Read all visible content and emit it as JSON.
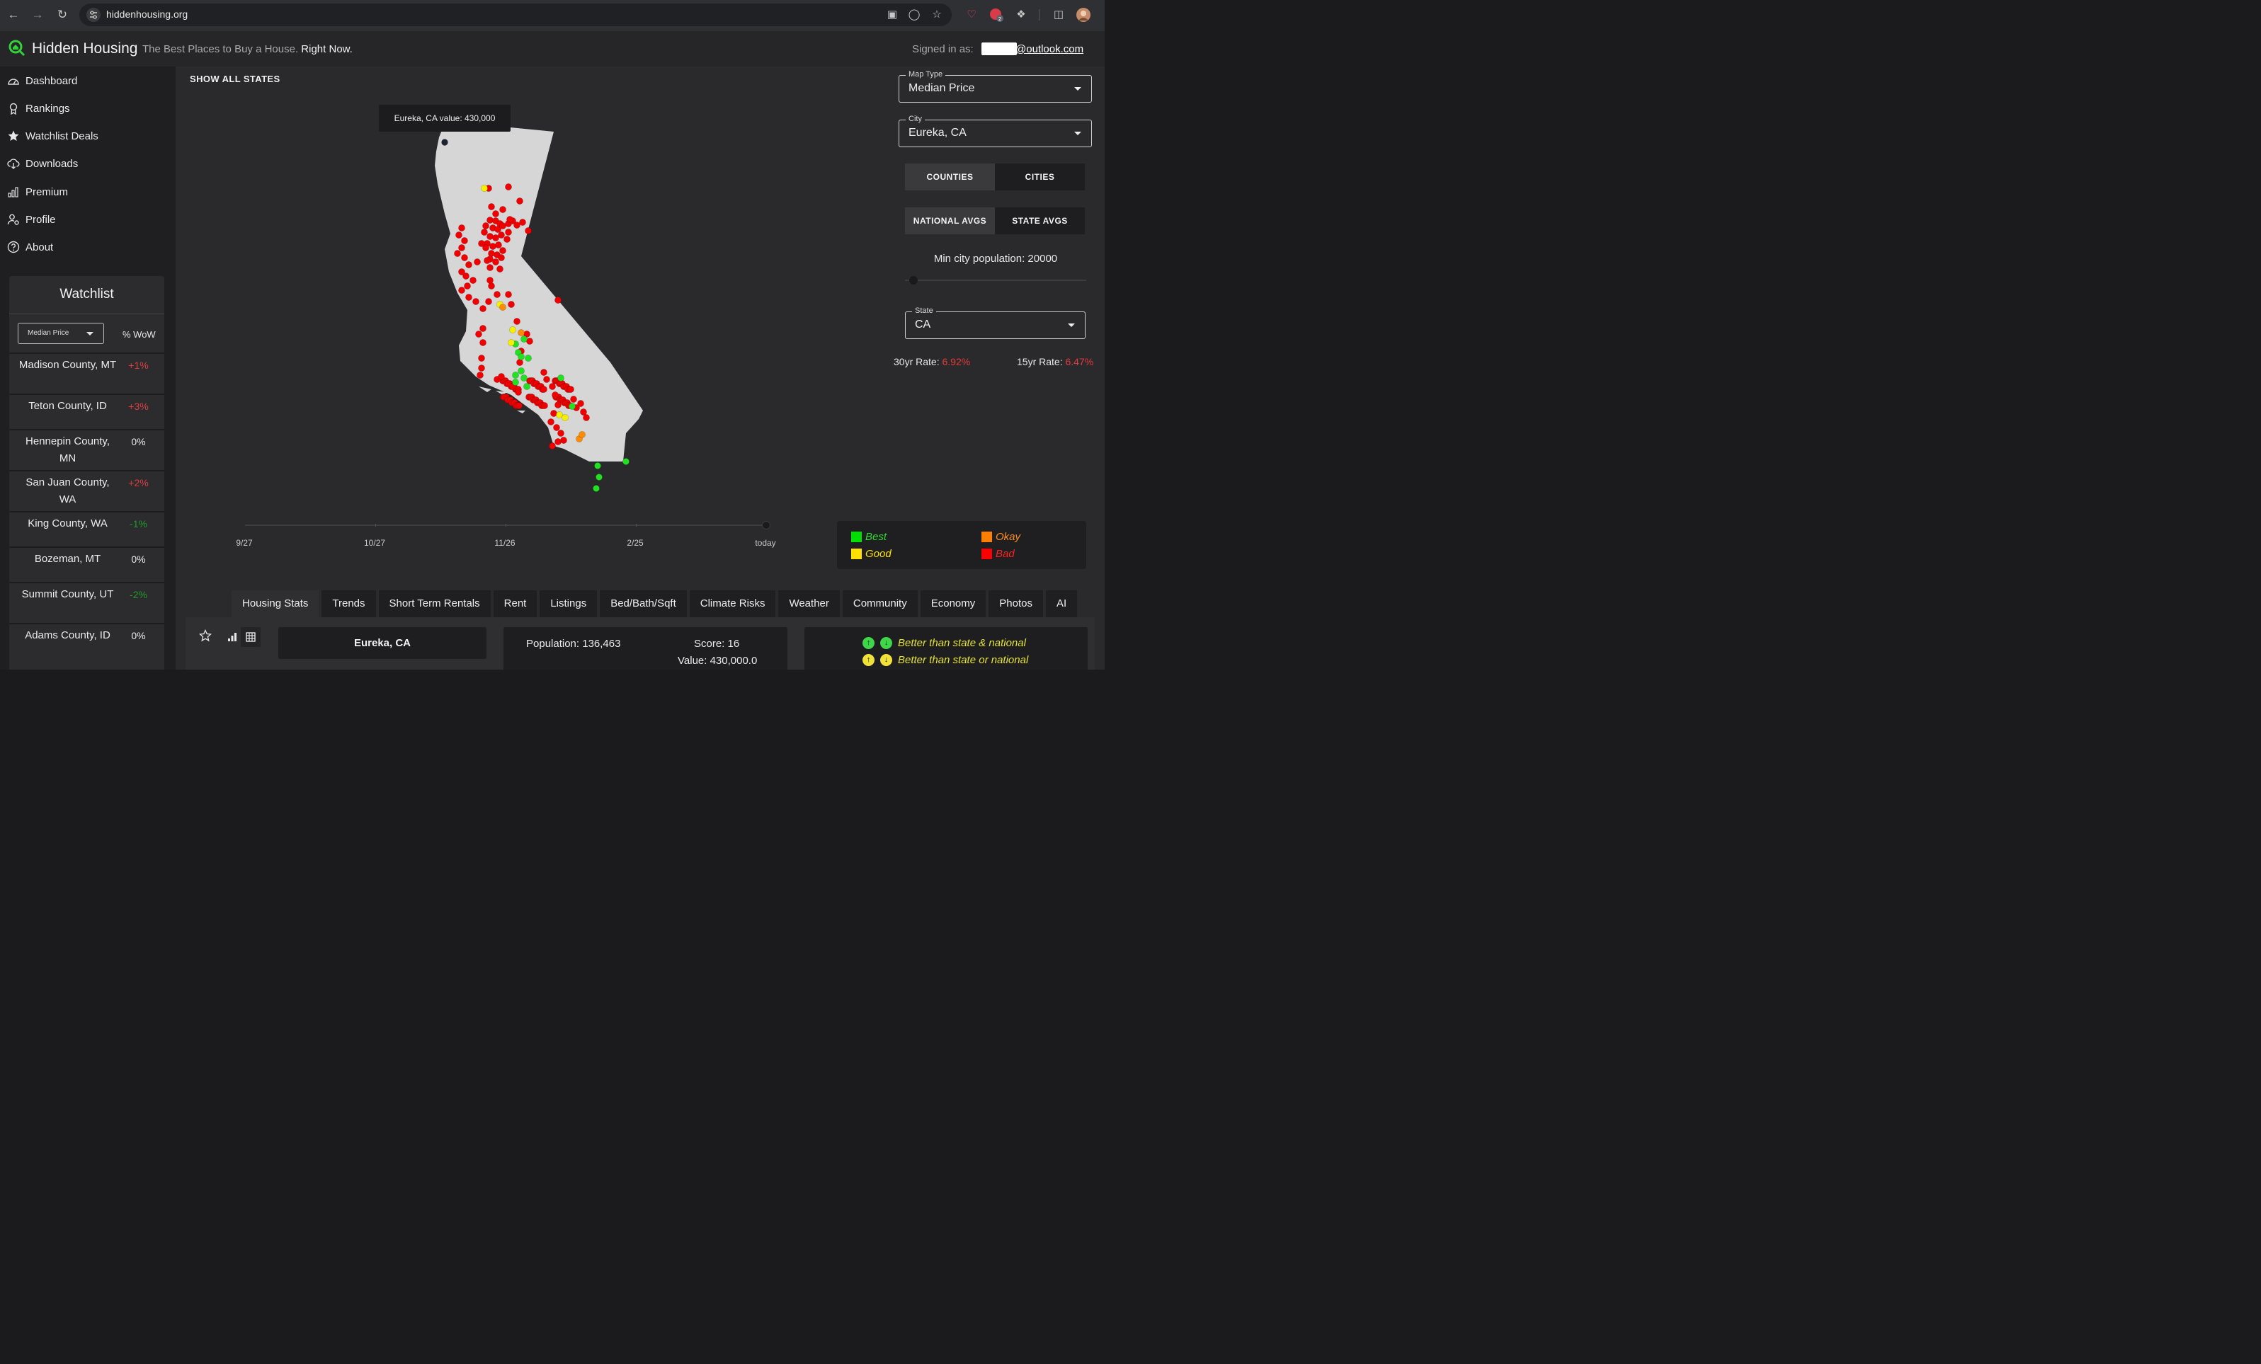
{
  "browser": {
    "url": "hiddenhousing.org",
    "extension_badge": "2"
  },
  "header": {
    "brand": "Hidden Housing",
    "tagline_prefix": "The Best Places to Buy a House.",
    "tagline_emph": "Right Now.",
    "signed_in_label": "Signed in as:",
    "email": "@outlook.com"
  },
  "sidebar": {
    "items": [
      {
        "label": "Dashboard",
        "icon": "dashboard-icon"
      },
      {
        "label": "Rankings",
        "icon": "ribbon-icon"
      },
      {
        "label": "Watchlist Deals",
        "icon": "star-icon"
      },
      {
        "label": "Downloads",
        "icon": "cloud-download-icon"
      },
      {
        "label": "Premium",
        "icon": "chart-icon"
      },
      {
        "label": "Profile",
        "icon": "user-gear-icon"
      },
      {
        "label": "About",
        "icon": "help-icon"
      }
    ]
  },
  "watchlist": {
    "title": "Watchlist",
    "metric": "Median Price",
    "change_header": "% WoW",
    "rows": [
      {
        "name": "Madison County, MT",
        "change": "+1%",
        "trend": "up"
      },
      {
        "name": "Teton County, ID",
        "change": "+3%",
        "trend": "up"
      },
      {
        "name": "Hennepin County, MN",
        "change": "0%",
        "trend": "flat"
      },
      {
        "name": "San Juan County, WA",
        "change": "+2%",
        "trend": "up"
      },
      {
        "name": "King County, WA",
        "change": "-1%",
        "trend": "down"
      },
      {
        "name": "Bozeman, MT",
        "change": "0%",
        "trend": "flat"
      },
      {
        "name": "Summit County, UT",
        "change": "-2%",
        "trend": "down"
      },
      {
        "name": "Adams County, ID",
        "change": "0%",
        "trend": "flat"
      }
    ]
  },
  "map": {
    "show_all_label": "SHOW ALL STATES",
    "tooltip": "Eureka, CA value: 430,000",
    "timeline_labels": [
      "9/27",
      "10/27",
      "11/26",
      "2/25",
      "today"
    ],
    "legend": [
      {
        "label": "Best",
        "color": "#00e000"
      },
      {
        "label": "Okay",
        "color": "#ff8000"
      },
      {
        "label": "Good",
        "color": "#ffe000"
      },
      {
        "label": "Bad",
        "color": "#ff0000"
      }
    ]
  },
  "controls": {
    "map_type_label": "Map Type",
    "map_type_value": "Median Price",
    "city_label": "City",
    "city_value": "Eureka, CA",
    "level_toggle": [
      "COUNTIES",
      "CITIES"
    ],
    "avg_toggle": [
      "NATIONAL AVGS",
      "STATE AVGS"
    ],
    "min_pop_text": "Min city population: 20000",
    "state_label": "State",
    "state_value": "CA",
    "rate30_label": "30yr Rate:",
    "rate30_value": "6.92%",
    "rate15_label": "15yr Rate:",
    "rate15_value": "6.47%"
  },
  "tabs": [
    "Housing Stats",
    "Trends",
    "Short Term Rentals",
    "Rent",
    "Listings",
    "Bed/Bath/Sqft",
    "Climate Risks",
    "Weather",
    "Community",
    "Economy",
    "Photos",
    "AI"
  ],
  "stats": {
    "city": "Eureka, CA",
    "population": "Population: 136,463",
    "score": "Score: 16",
    "value": "Value: 430,000.0",
    "better_all": "Better than state & national",
    "better_either": "Better than state or national"
  }
}
